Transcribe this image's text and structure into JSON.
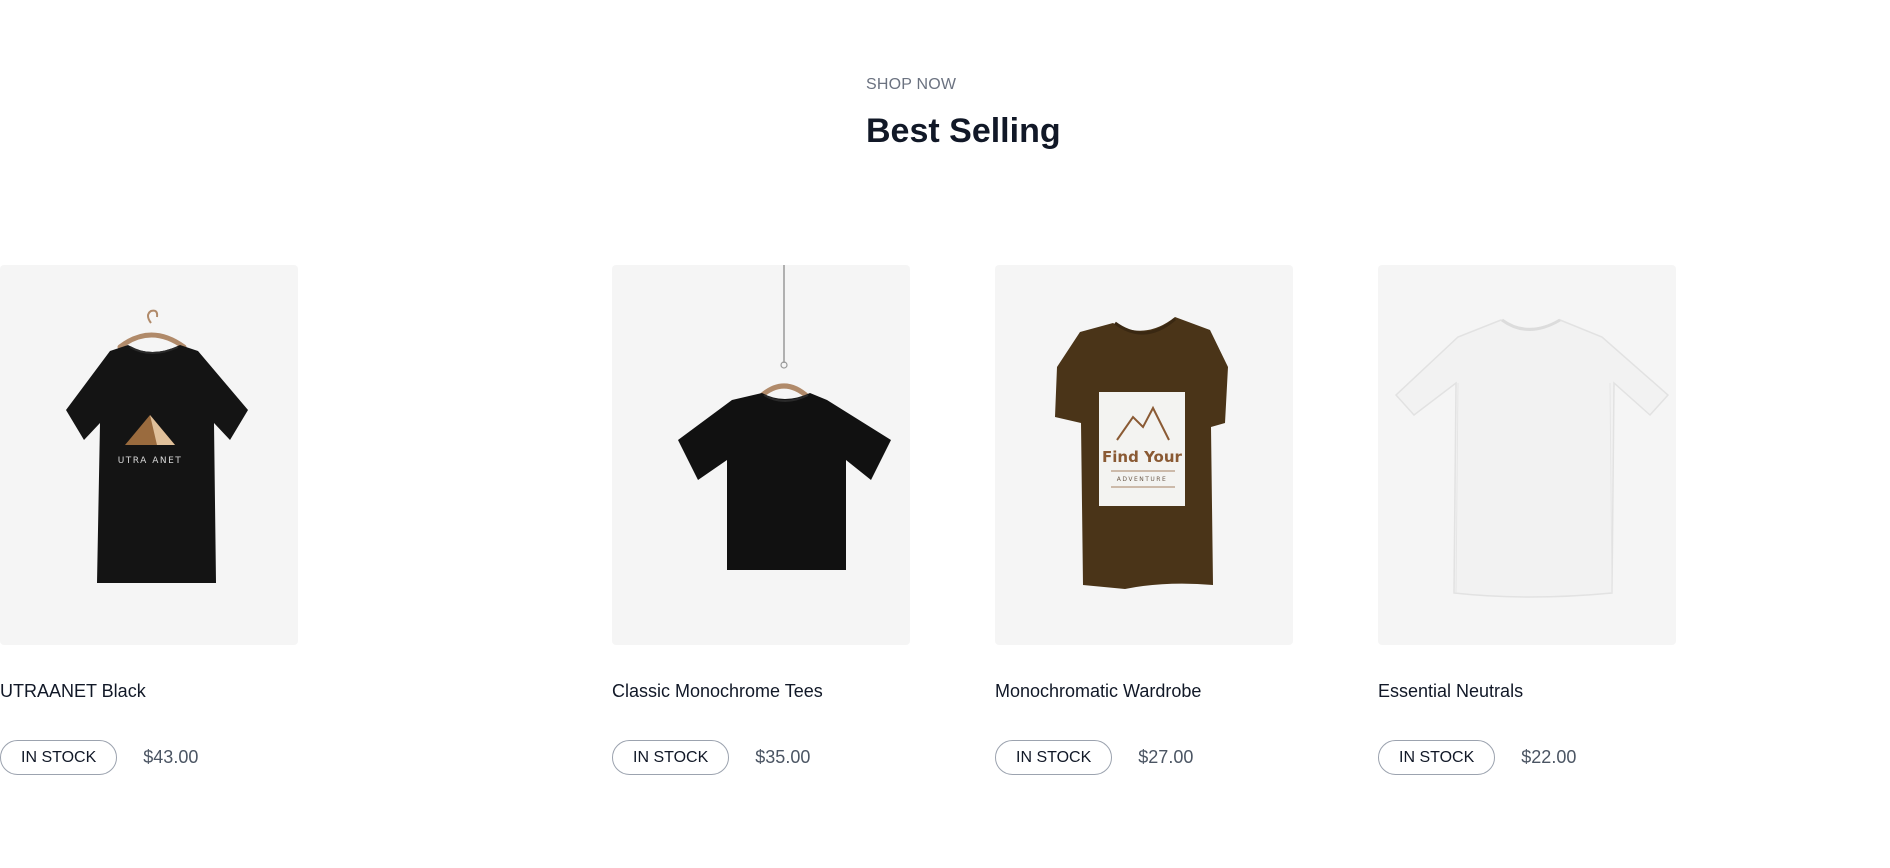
{
  "section": {
    "eyebrow": "SHOP NOW",
    "title": "Best Selling"
  },
  "products": [
    {
      "name": "Classic Monochrome Tees",
      "stock": "IN STOCK",
      "price": "$35.00",
      "image_icon": "black-tshirt-on-hanger",
      "color": "#111111"
    },
    {
      "name": "Monochromatic Wardrobe",
      "stock": "IN STOCK",
      "price": "$27.00",
      "image_icon": "brown-graphic-tshirt",
      "color": "#4a3418",
      "graphic": {
        "headline": "Find Your",
        "subline": "ADVENTURE"
      }
    },
    {
      "name": "Essential Neutrals",
      "stock": "IN STOCK",
      "price": "$22.00",
      "image_icon": "white-tshirt",
      "color": "#f2f2f2"
    },
    {
      "name": "UTRAANET Black",
      "stock": "IN STOCK",
      "price": "$43.00",
      "image_icon": "black-logo-tshirt-on-hanger",
      "color": "#141414",
      "graphic": {
        "brand": "UTRA ANET"
      }
    }
  ],
  "colors": {
    "card_bg": "#f5f5f5",
    "text": "#111827",
    "muted": "#6b7280",
    "badge_border": "#9ca3af"
  }
}
